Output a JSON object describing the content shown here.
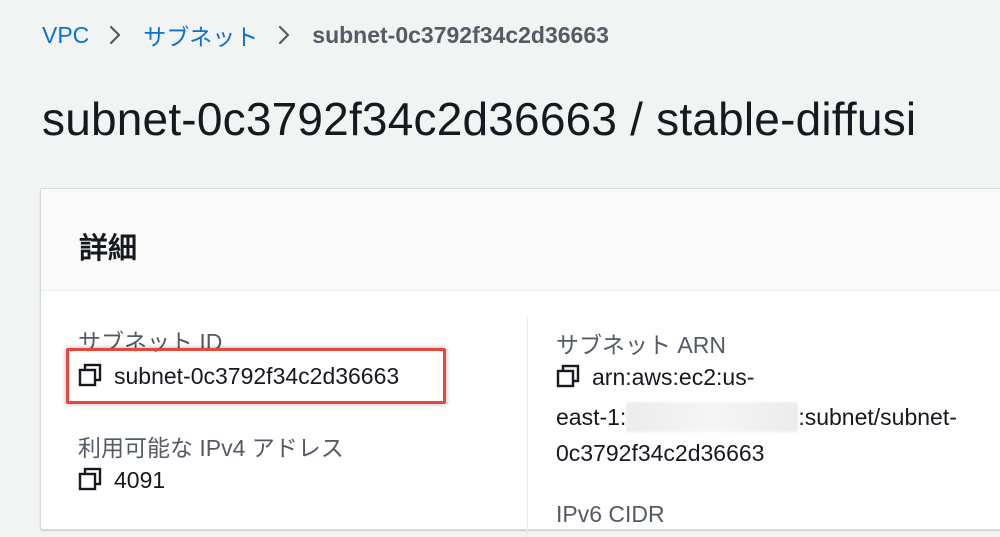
{
  "breadcrumb": {
    "items": [
      {
        "label": "VPC"
      },
      {
        "label": "サブネット"
      },
      {
        "label": "subnet-0c3792f34c2d36663"
      }
    ]
  },
  "page": {
    "title": "subnet-0c3792f34c2d36663 / stable-diffusi"
  },
  "details": {
    "title": "詳細",
    "subnet_id": {
      "label": "サブネット ID",
      "value": "subnet-0c3792f34c2d36663"
    },
    "available_ips": {
      "label": "利用可能な IPv4 アドレス",
      "value": "4091"
    },
    "subnet_arn": {
      "label": "サブネット ARN",
      "line1": "arn:aws:ec2:us-",
      "line2_prefix": "east-1:",
      "line2_suffix": ":subnet/subnet-",
      "line3": "0c3792f34c2d36663"
    },
    "next_label_partial": "IPv6 CIDR"
  },
  "icons": {
    "breadcrumb_separator": "chevron-right-icon",
    "copy": "copy-icon"
  },
  "colors": {
    "link": "#0972d3",
    "highlight": "#e8463a",
    "background": "#f2f3f3"
  }
}
